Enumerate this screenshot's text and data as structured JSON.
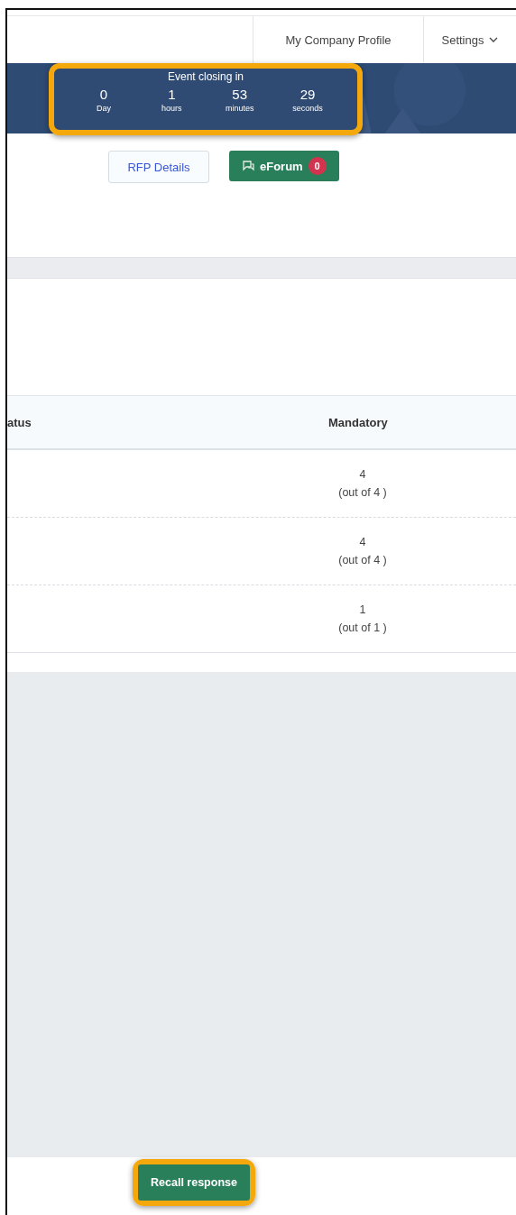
{
  "nav": {
    "items": [
      {
        "label": "My Company Profile",
        "kind": "link"
      },
      {
        "label": "Settings",
        "kind": "dropdown"
      }
    ]
  },
  "countdown": {
    "title": "Event closing in",
    "units": [
      {
        "value": "0",
        "unit": "Day"
      },
      {
        "value": "1",
        "unit": "hours"
      },
      {
        "value": "53",
        "unit": "minutes"
      },
      {
        "value": "29",
        "unit": "seconds"
      }
    ],
    "highlighted": true
  },
  "actions": {
    "rfp_button": "RFP Details",
    "forum_button": "eForum",
    "forum_count": "0"
  },
  "table": {
    "columns": [
      "atus",
      "Mandatory"
    ],
    "rows": [
      {
        "count": "4",
        "total": "(out of 4 )"
      },
      {
        "count": "4",
        "total": "(out of 4 )"
      },
      {
        "count": "1",
        "total": "(out of 1 )"
      }
    ]
  },
  "footer": {
    "button": "Recall response",
    "highlighted": true
  }
}
